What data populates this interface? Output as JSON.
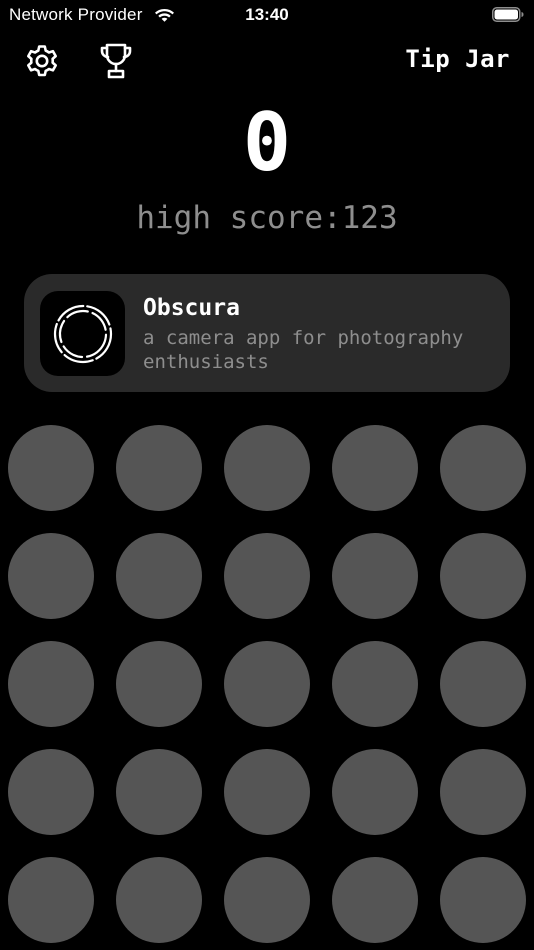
{
  "status_bar": {
    "carrier": "Network Provider",
    "time": "13:40",
    "wifi_icon": "wifi-icon",
    "battery_icon": "battery-full-icon"
  },
  "toolbar": {
    "settings_icon": "gear-icon",
    "leaderboard_icon": "trophy-icon",
    "tip_jar_label": "Tip Jar"
  },
  "game": {
    "score": "0",
    "high_score": "high score:123",
    "circle_rows": 5,
    "circle_cols": 5
  },
  "promo": {
    "title": "Obscura",
    "subtitle": "a camera app for photography enthusiasts",
    "icon": "camera-aperture-icon"
  },
  "colors": {
    "background": "#000000",
    "card": "#2a2a2a",
    "circle": "#555555",
    "muted_text": "#8e8e8e",
    "text": "#ffffff"
  }
}
